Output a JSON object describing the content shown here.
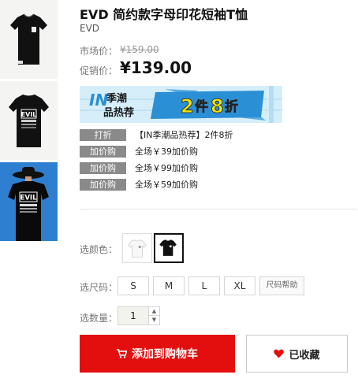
{
  "product": {
    "title": "EVD 简约款字母印花短袖T恤",
    "brand": "EVD",
    "market_price_label": "市场价：",
    "market_price": "¥159.00",
    "promo_price_label": "促销价：",
    "promo_price": "¥139.00"
  },
  "banner": {
    "in_text": "IN",
    "line1": "季潮",
    "line2": "品热荐",
    "num1": "2",
    "word1": "件",
    "num2": "8",
    "word2": "折"
  },
  "promotions": [
    {
      "tag": "打折",
      "text": "【IN季潮品热荐】2件8折"
    },
    {
      "tag": "加价购",
      "text": "全场￥39加价购"
    },
    {
      "tag": "加价购",
      "text": "全场￥99加价购"
    },
    {
      "tag": "加价购",
      "text": "全场￥59加价购"
    }
  ],
  "options": {
    "color_label": "选颜色：",
    "size_label": "选尺码：",
    "sizes": [
      "S",
      "M",
      "L",
      "XL"
    ],
    "size_help": "尺码帮助",
    "qty_label": "选数量：",
    "qty_value": "1"
  },
  "actions": {
    "add_to_cart": "添加到购物车",
    "favorited": "已收藏"
  },
  "thumb_text": {
    "evil": "EVIL"
  },
  "colors": {
    "accent_red": "#e30e0e",
    "tag_gray": "#8a8a8a",
    "banner_blue": "#2b8fd6",
    "banner_yellow": "#f7e400"
  }
}
